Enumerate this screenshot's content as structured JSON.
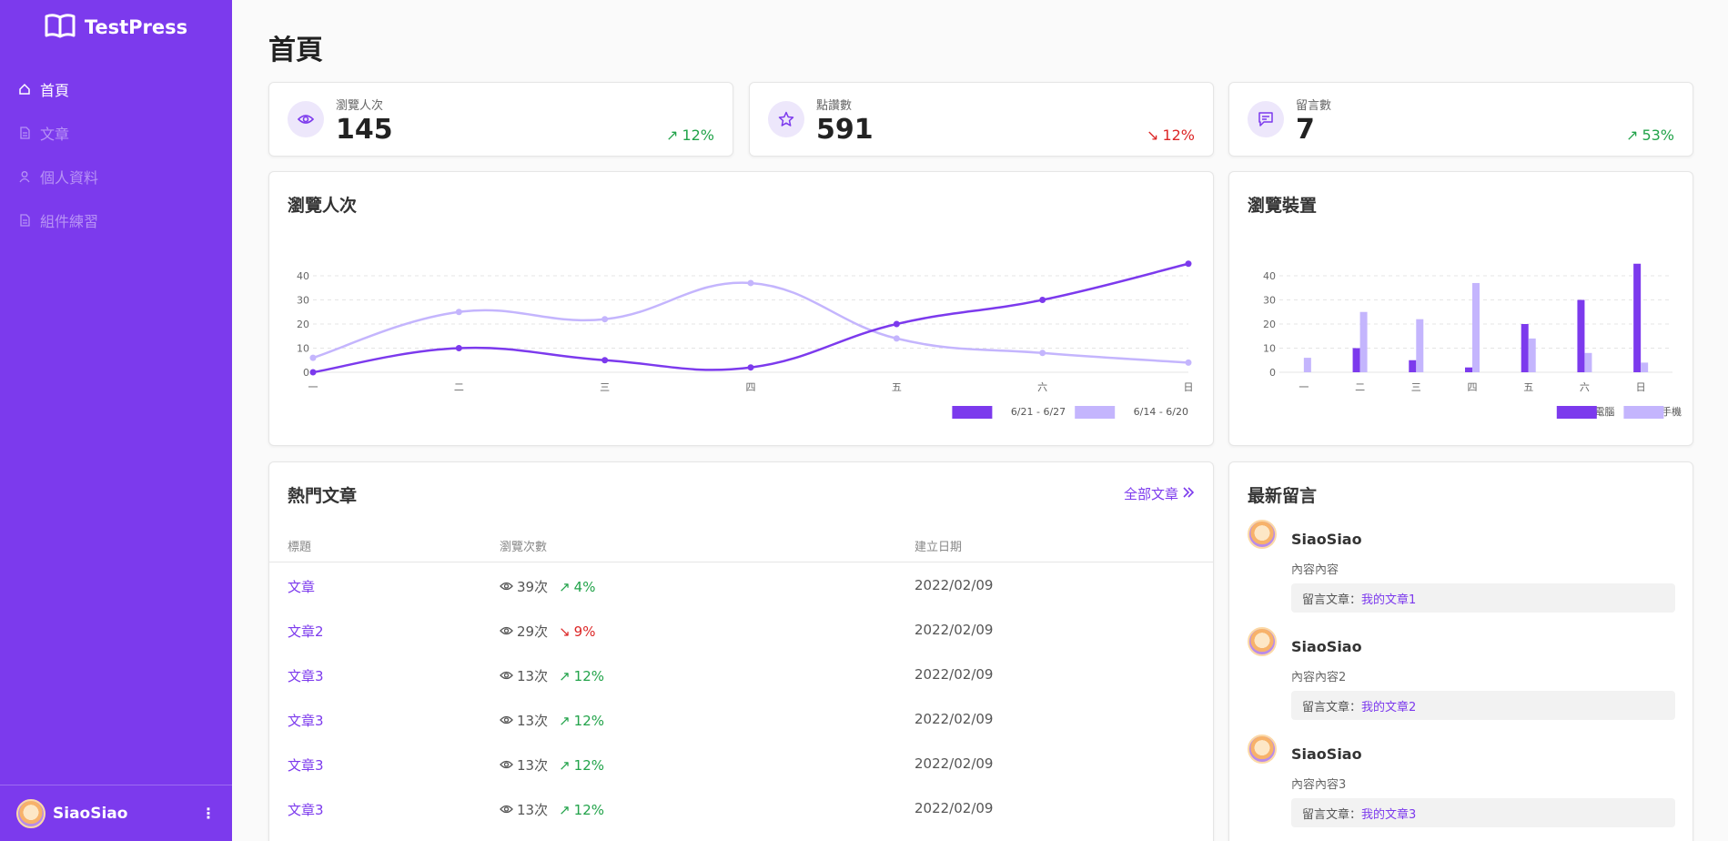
{
  "app": {
    "brand": "TestPress"
  },
  "sidebar": {
    "items": [
      {
        "label": "首頁",
        "icon": "home-icon",
        "active": true
      },
      {
        "label": "文章",
        "icon": "file-icon",
        "active": false
      },
      {
        "label": "個人資料",
        "icon": "user-icon",
        "active": false
      },
      {
        "label": "組件練習",
        "icon": "file-icon",
        "active": false
      }
    ],
    "user": {
      "name": "SiaoSiao"
    }
  },
  "page": {
    "title": "首頁"
  },
  "stats": [
    {
      "label": "瀏覽人次",
      "value": "145",
      "change": "12%",
      "trend": "up",
      "icon": "eye-icon"
    },
    {
      "label": "點讚數",
      "value": "591",
      "change": "12%",
      "trend": "down",
      "icon": "star-icon"
    },
    {
      "label": "留言數",
      "value": "7",
      "change": "53%",
      "trend": "up",
      "icon": "comment-icon"
    }
  ],
  "colors": {
    "primary": "#7c3aed",
    "secondary": "#c4b5fd",
    "up": "#22a34a",
    "down": "#dc2626"
  },
  "chart_data": [
    {
      "type": "line",
      "title": "瀏覽人次",
      "categories": [
        "一",
        "二",
        "三",
        "四",
        "五",
        "六",
        "日"
      ],
      "ylim": [
        0,
        45
      ],
      "yticks": [
        0,
        10,
        20,
        30,
        40
      ],
      "grid": true,
      "legend": "bottom-right",
      "series": [
        {
          "name": "6/21 - 6/27",
          "values": [
            0,
            10,
            5,
            2,
            20,
            30,
            45
          ],
          "color": "#7c3aed"
        },
        {
          "name": "6/14 - 6/20",
          "values": [
            6,
            25,
            22,
            37,
            14,
            8,
            4
          ],
          "color": "#c4b5fd"
        }
      ]
    },
    {
      "type": "bar",
      "title": "瀏覽裝置",
      "categories": [
        "一",
        "二",
        "三",
        "四",
        "五",
        "六",
        "日"
      ],
      "ylim": [
        0,
        45
      ],
      "yticks": [
        0,
        10,
        20,
        30,
        40
      ],
      "grid": true,
      "legend": "bottom-right",
      "series": [
        {
          "name": "電腦",
          "values": [
            0,
            10,
            5,
            2,
            20,
            30,
            45
          ],
          "color": "#7c3aed"
        },
        {
          "name": "手機",
          "values": [
            6,
            25,
            22,
            37,
            14,
            8,
            4
          ],
          "color": "#c4b5fd"
        }
      ]
    }
  ],
  "hot_posts": {
    "title": "熱門文章",
    "link_all": "全部文章",
    "columns": [
      "標題",
      "瀏覽次數",
      "建立日期"
    ],
    "rows": [
      {
        "title": "文章",
        "views": "39次",
        "change": "4%",
        "trend": "up",
        "date": "2022/02/09"
      },
      {
        "title": "文章2",
        "views": "29次",
        "change": "9%",
        "trend": "down",
        "date": "2022/02/09"
      },
      {
        "title": "文章3",
        "views": "13次",
        "change": "12%",
        "trend": "up",
        "date": "2022/02/09"
      },
      {
        "title": "文章3",
        "views": "13次",
        "change": "12%",
        "trend": "up",
        "date": "2022/02/09"
      },
      {
        "title": "文章3",
        "views": "13次",
        "change": "12%",
        "trend": "up",
        "date": "2022/02/09"
      },
      {
        "title": "文章3",
        "views": "13次",
        "change": "12%",
        "trend": "up",
        "date": "2022/02/09"
      }
    ]
  },
  "comments": {
    "title": "最新留言",
    "items": [
      {
        "name": "SiaoSiao",
        "body": "內容內容",
        "ref_prefix": "留言文章：",
        "ref_title": "我的文章1"
      },
      {
        "name": "SiaoSiao",
        "body": "內容內容2",
        "ref_prefix": "留言文章：",
        "ref_title": "我的文章2"
      },
      {
        "name": "SiaoSiao",
        "body": "內容內容3",
        "ref_prefix": "留言文章：",
        "ref_title": "我的文章3"
      }
    ]
  }
}
